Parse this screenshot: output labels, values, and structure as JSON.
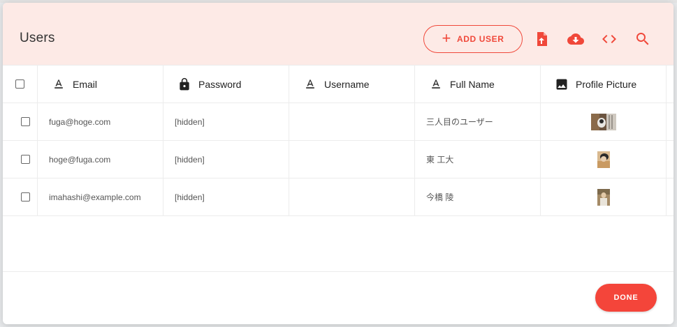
{
  "dialog": {
    "title": "Users",
    "add_user_label": "ADD USER",
    "done_label": "DONE",
    "accent_color": "#f0483a",
    "header_bg": "#fdeae6",
    "toolbar_icons": [
      "file-upload-icon",
      "cloud-download-icon",
      "code-icon",
      "search-icon"
    ]
  },
  "table": {
    "columns": [
      {
        "label": "Email",
        "icon": "text-format-icon"
      },
      {
        "label": "Password",
        "icon": "lock-icon"
      },
      {
        "label": "Username",
        "icon": "text-format-icon"
      },
      {
        "label": "Full Name",
        "icon": "text-format-icon"
      },
      {
        "label": "Profile Picture",
        "icon": "image-icon"
      }
    ],
    "rows": [
      {
        "email": "fuga@hoge.com",
        "password": "[hidden]",
        "username": "",
        "full_name": "三人目のユーザー"
      },
      {
        "email": "hoge@fuga.com",
        "password": "[hidden]",
        "username": "",
        "full_name": "東 工大"
      },
      {
        "email": "imahashi@example.com",
        "password": "[hidden]",
        "username": "",
        "full_name": "今橋 陵"
      }
    ]
  }
}
